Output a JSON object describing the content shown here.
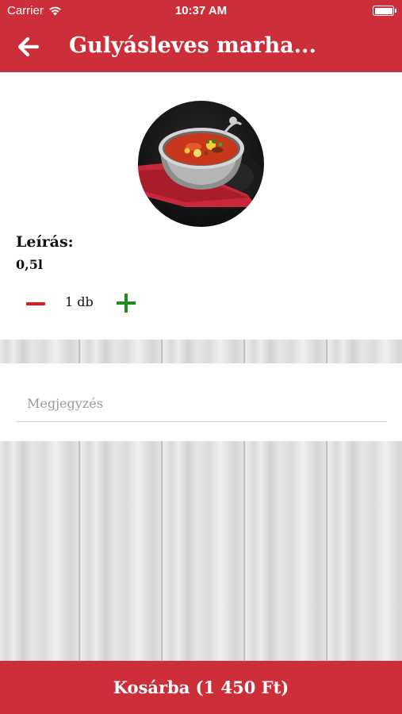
{
  "status_bar": {
    "carrier": "Carrier",
    "time": "10:37 AM",
    "icons": [
      "wifi-icon",
      "battery-icon"
    ]
  },
  "nav": {
    "back_icon": "arrow-left-icon",
    "title": "Gulyásleves marha..."
  },
  "product": {
    "image": "goulash-soup-photo",
    "description_heading": "Leírás:",
    "description": "0,5l",
    "quantity": "1 db"
  },
  "note": {
    "placeholder": "Megjegyzés",
    "value": ""
  },
  "cart_button": {
    "label": "Kosárba (1 450 Ft)"
  },
  "colors": {
    "brand_red": "#cc2f3a",
    "minus_red": "#e01820",
    "plus_green": "#1f8a1f"
  }
}
